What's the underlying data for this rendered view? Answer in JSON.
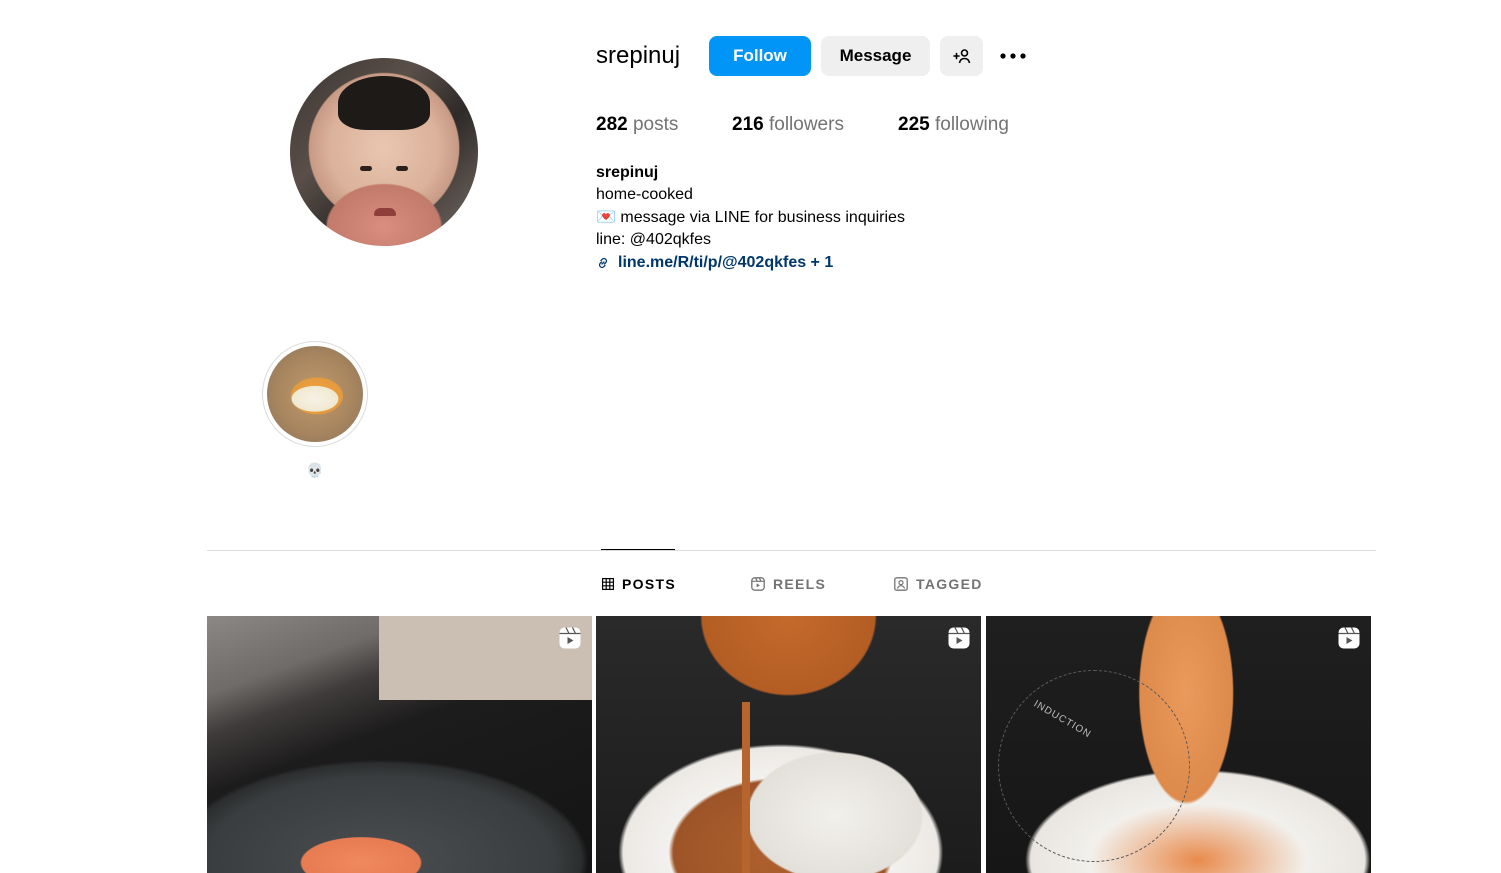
{
  "profile": {
    "username": "srepinuj",
    "follow_label": "Follow",
    "message_label": "Message",
    "stats": [
      {
        "count": "282",
        "label": "posts"
      },
      {
        "count": "216",
        "label": "followers"
      },
      {
        "count": "225",
        "label": "following"
      }
    ],
    "bio": {
      "name": "srepinuj",
      "line1": "home-cooked",
      "line2_emoji": "💌",
      "line2": "message via LINE for business inquiries",
      "line3": "line: @402qkfes",
      "link": "line.me/R/ti/p/@402qkfes + 1"
    }
  },
  "highlights": [
    {
      "title": "💀"
    }
  ],
  "tabs": [
    {
      "label": "POSTS",
      "icon": "grid-icon",
      "active": true
    },
    {
      "label": "REELS",
      "icon": "reels-icon",
      "active": false
    },
    {
      "label": "TAGGED",
      "icon": "tagged-icon",
      "active": false
    }
  ],
  "posts": [
    {
      "type": "reel",
      "subject": "salmon in pan"
    },
    {
      "type": "reel",
      "subject": "curry over rice"
    },
    {
      "type": "reel",
      "subject": "noodles",
      "overlay_text": "INDUCTION"
    }
  ],
  "colors": {
    "accent": "#0095f6",
    "link": "#00376b",
    "secondary_text": "#737373"
  }
}
